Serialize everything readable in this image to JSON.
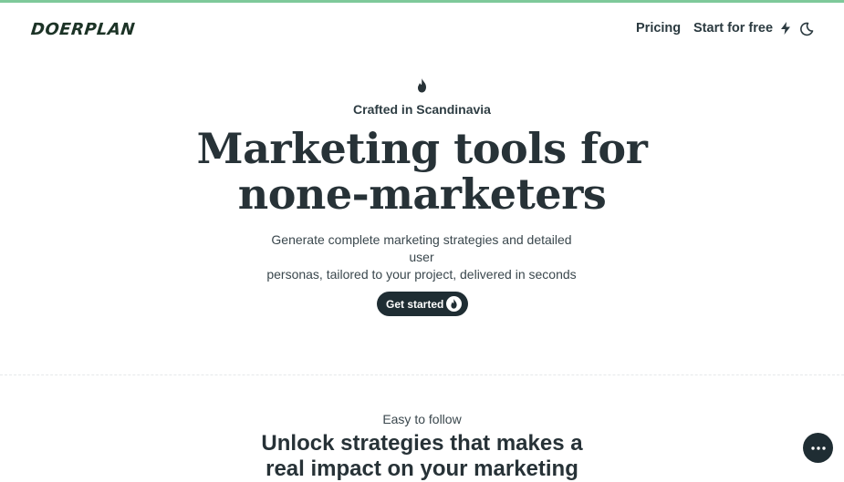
{
  "colors": {
    "accent_bar": "#7ec99a",
    "logo": "#1c3326",
    "dark": "#1f2d33"
  },
  "header": {
    "logo": "DOERPLAN",
    "nav_pricing": "Pricing",
    "nav_start": "Start for free",
    "start_icon": "lightning-icon",
    "theme_icon": "moon-icon"
  },
  "hero": {
    "icon": "flame-icon",
    "eyebrow": "Crafted in Scandinavia",
    "headline_line1": "Marketing tools for",
    "headline_line2": "none-marketers",
    "sub_line1": "Generate complete marketing strategies and detailed user",
    "sub_line2": "personas, tailored to your project, delivered in seconds",
    "cta_label": "Get started",
    "cta_icon": "flame-icon"
  },
  "section2": {
    "eyebrow": "Easy to follow",
    "headline_line1": "Unlock strategies that makes a",
    "headline_line2": "real impact on your marketing"
  },
  "fab": {
    "icon": "more-icon"
  }
}
